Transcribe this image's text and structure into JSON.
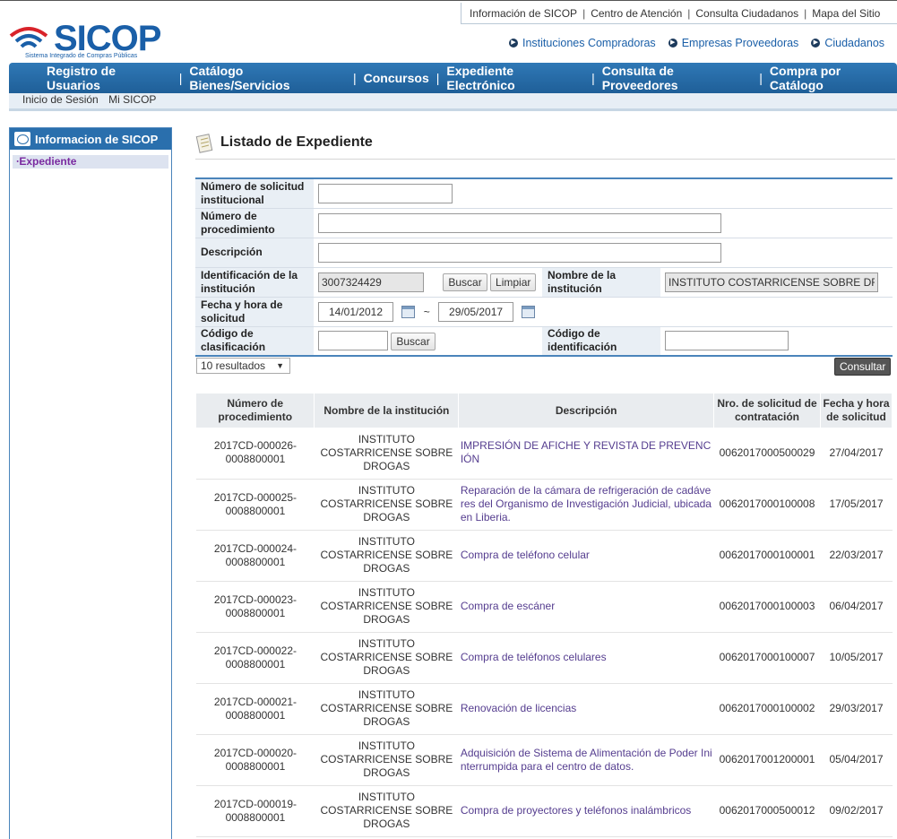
{
  "top_links": [
    "Información de SICOP",
    "Centro de Atención",
    "Consulta Ciudadanos",
    "Mapa del Sitio"
  ],
  "logo": {
    "name": "SICOP",
    "tagline": "Sistema Integrado de Compras Públicas"
  },
  "secondary_nav": [
    "Instituciones Compradoras",
    "Empresas Proveedoras",
    "Ciudadanos"
  ],
  "main_nav": [
    "Registro de Usuarios",
    "Catálogo Bienes/Servicios",
    "Concursos",
    "Expediente Electrónico",
    "Consulta de Proveedores",
    "Compra por Catálogo"
  ],
  "sub_nav": [
    "Inicio de Sesión",
    "Mi SICOP"
  ],
  "sidebar": {
    "title": "Informacion de SICOP",
    "items": [
      "Expediente"
    ]
  },
  "page_title": "Listado de Expediente",
  "form": {
    "solicitud_label": "Número de solicitud institucional",
    "solicitud_value": "",
    "procedimiento_label": "Número de procedimiento",
    "procedimiento_value": "",
    "descripcion_label": "Descripción",
    "descripcion_value": "",
    "identificacion_label": "Identificación de la institución",
    "identificacion_value": "3007324429",
    "buscar_label": "Buscar",
    "limpiar_label": "Limpiar",
    "nombre_label": "Nombre de la institución",
    "nombre_value": "INSTITUTO COSTARRICENSE SOBRE DROGAS",
    "fecha_label": "Fecha y hora de solicitud",
    "fecha_desde": "14/01/2012",
    "fecha_sep": "~",
    "fecha_hasta": "29/05/2017",
    "clasificacion_label": "Código de clasificación",
    "clasificacion_value": "",
    "buscar2_label": "Buscar",
    "codigo_id_label": "Código de identificación",
    "codigo_id_value": ""
  },
  "results_select": "10 resultados",
  "consultar_label": "Consultar",
  "table": {
    "headers": [
      "Número de procedimiento",
      "Nombre de la institución",
      "Descripción",
      "Nro. de solicitud de contratación",
      "Fecha y hora de solicitud"
    ],
    "rows": [
      {
        "num": "2017CD-000026-0008800001",
        "inst": "INSTITUTO COSTARRICENSE SOBRE DROGAS",
        "desc": "IMPRESIÓN DE AFICHE Y REVISTA DE PREVENCIÓN",
        "sol": "0062017000500029",
        "fecha": "27/04/2017"
      },
      {
        "num": "2017CD-000025-0008800001",
        "inst": "INSTITUTO COSTARRICENSE SOBRE DROGAS",
        "desc": "Reparación de la cámara de refrigeración de cadáveres del Organismo de Investigación Judicial, ubicada en Liberia.",
        "sol": "0062017000100008",
        "fecha": "17/05/2017"
      },
      {
        "num": "2017CD-000024-0008800001",
        "inst": "INSTITUTO COSTARRICENSE SOBRE DROGAS",
        "desc": "Compra de teléfono celular",
        "sol": "0062017000100001",
        "fecha": "22/03/2017"
      },
      {
        "num": "2017CD-000023-0008800001",
        "inst": "INSTITUTO COSTARRICENSE SOBRE DROGAS",
        "desc": "Compra de escáner",
        "sol": "0062017000100003",
        "fecha": "06/04/2017"
      },
      {
        "num": "2017CD-000022-0008800001",
        "inst": "INSTITUTO COSTARRICENSE SOBRE DROGAS",
        "desc": "Compra de teléfonos celulares",
        "sol": "0062017000100007",
        "fecha": "10/05/2017"
      },
      {
        "num": "2017CD-000021-0008800001",
        "inst": "INSTITUTO COSTARRICENSE SOBRE DROGAS",
        "desc": "Renovación de licencias",
        "sol": "0062017000100002",
        "fecha": "29/03/2017"
      },
      {
        "num": "2017CD-000020-0008800001",
        "inst": "INSTITUTO COSTARRICENSE SOBRE DROGAS",
        "desc": "Adquisición de Sistema de Alimentación de Poder Ininterrumpida para el centro de datos.",
        "sol": "0062017001200001",
        "fecha": "05/04/2017"
      },
      {
        "num": "2017CD-000019-0008800001",
        "inst": "INSTITUTO COSTARRICENSE SOBRE DROGAS",
        "desc": "Compra de proyectores y teléfonos inalámbricos",
        "sol": "0062017000500012",
        "fecha": "09/02/2017"
      }
    ]
  }
}
